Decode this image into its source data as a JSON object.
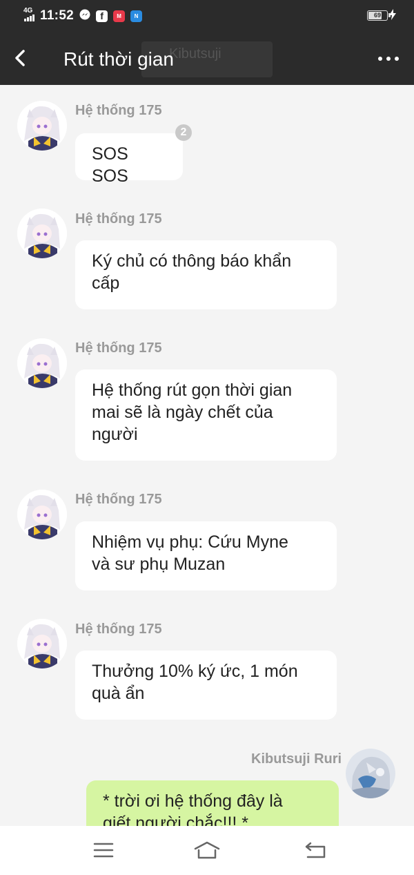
{
  "status_bar": {
    "network": "4G",
    "time": "11:52",
    "battery": "69",
    "battery_level": 0.69,
    "notification_icons": [
      "messenger-icon",
      "facebook-icon",
      "mangatoon-icon",
      "novel-app-icon"
    ]
  },
  "header": {
    "title": "Rút thời gian",
    "ghost_text": "Kibutsuji"
  },
  "messages": [
    {
      "sender": "Hệ thống 175",
      "text_lines": [
        "SOS SOS"
      ],
      "badge": "2"
    },
    {
      "sender": "Hệ thống 175",
      "text_lines": [
        "Ký chủ có thông báo khẩn",
        "cấp"
      ]
    },
    {
      "sender": "Hệ thống 175",
      "text_lines": [
        "Hệ thống rút gọn thời gian",
        "mai sẽ là ngày chết của",
        "người"
      ]
    },
    {
      "sender": "Hệ thống 175",
      "text_lines": [
        "Nhiệm vụ phụ: Cứu Myne",
        "và sư phụ Muzan"
      ]
    },
    {
      "sender": "Hệ thống 175",
      "text_lines": [
        "Thưởng 10% ký ức, 1 món",
        "quà ẩn"
      ]
    },
    {
      "sender": "Kibutsuji Ruri",
      "text_lines": [
        "* trời ơi hệ thống đây là",
        "giết người chắc!!! *"
      ],
      "mine": true
    }
  ],
  "colors": {
    "bar_bg": "#2b2b2b",
    "chat_bg": "#f4f4f4",
    "bubble_other": "#ffffff",
    "bubble_mine": "#d6f5a2"
  }
}
